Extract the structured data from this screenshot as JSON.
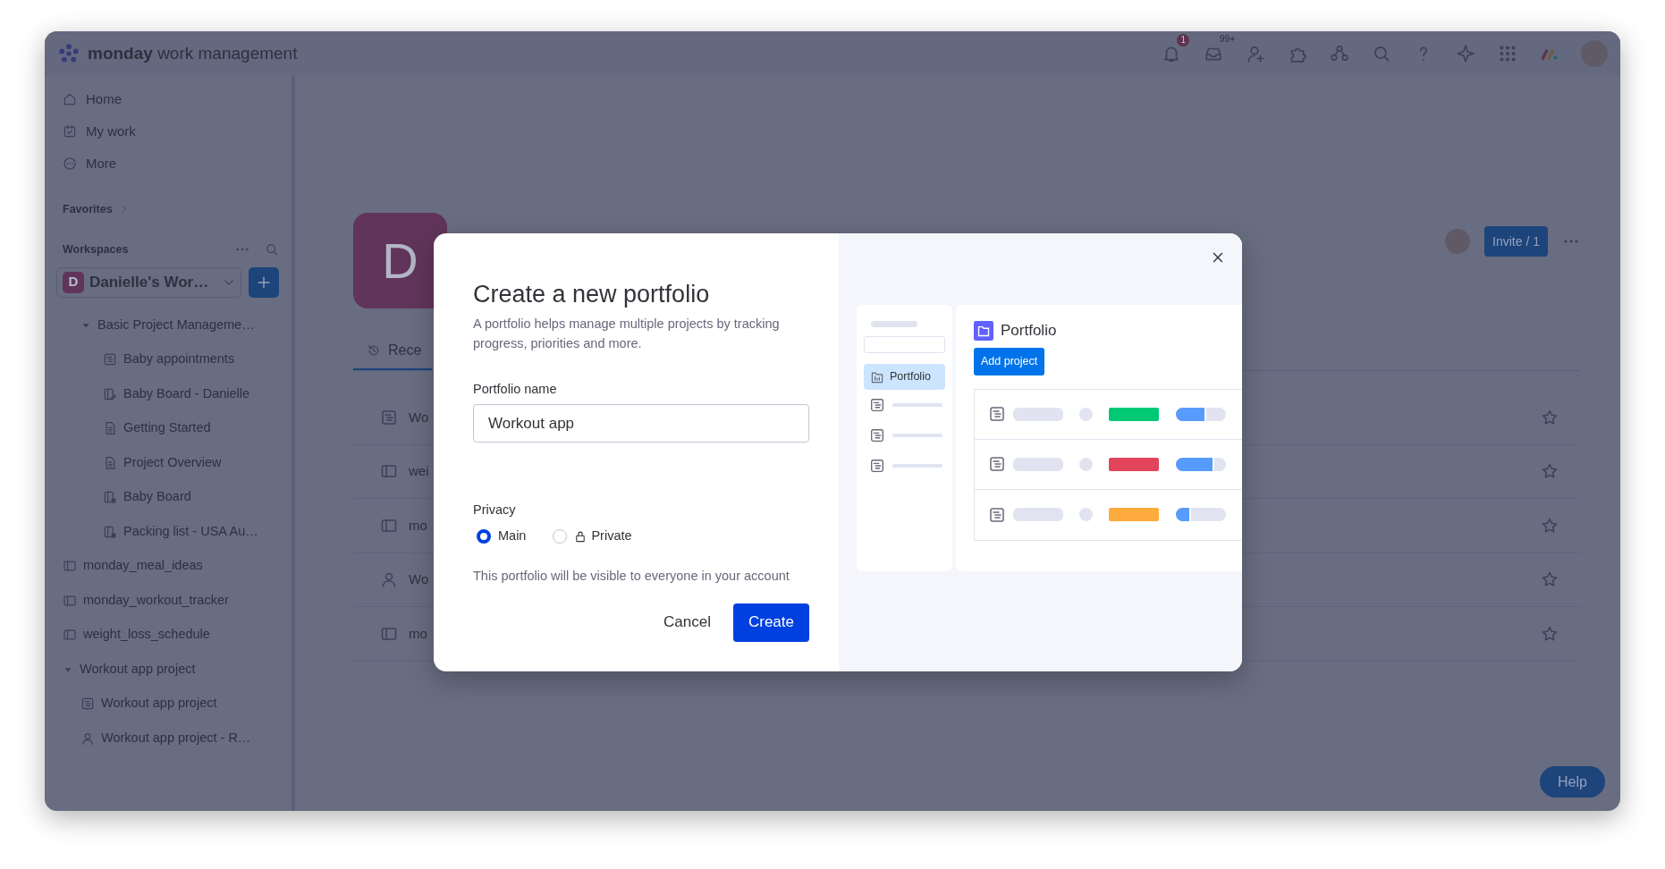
{
  "topbar": {
    "logo_bold": "monday",
    "logo_rest": "work management",
    "notifications_badge": "1",
    "inbox_badge": "99+"
  },
  "sidebar": {
    "nav": [
      {
        "label": "Home",
        "kind": "home"
      },
      {
        "label": "My work",
        "kind": "calendar"
      },
      {
        "label": "More",
        "kind": "more"
      }
    ],
    "favorites": "Favorites",
    "workspaces_label": "Workspaces",
    "workspace": {
      "initial": "D",
      "name": "Danielle's Wor…"
    },
    "tree": [
      {
        "label": "Basic Project Manageme…",
        "kind": "folder",
        "expanded": true,
        "children": [
          {
            "label": "Baby appointments",
            "kind": "board"
          },
          {
            "label": "Baby Board - Danielle",
            "kind": "shared"
          },
          {
            "label": "Getting Started",
            "kind": "doc"
          },
          {
            "label": "Project Overview",
            "kind": "doc"
          },
          {
            "label": "Baby Board",
            "kind": "locked"
          },
          {
            "label": "Packing list - USA Au…",
            "kind": "locked"
          }
        ]
      },
      {
        "label": "monday_meal_ideas",
        "kind": "table"
      },
      {
        "label": "monday_workout_tracker",
        "kind": "table"
      },
      {
        "label": "weight_loss_schedule",
        "kind": "table"
      },
      {
        "label": "Workout app project",
        "kind": "folder",
        "expanded": true,
        "children": [
          {
            "label": "Workout app project",
            "kind": "board"
          },
          {
            "label": "Workout app project - R…",
            "kind": "person"
          }
        ]
      }
    ]
  },
  "page": {
    "initial": "D",
    "tab": "Rece",
    "invite": "Invite / 1",
    "rows": [
      {
        "text": "Wo",
        "kind": "board"
      },
      {
        "text": "wei",
        "kind": "table"
      },
      {
        "text": "mo",
        "kind": "table"
      },
      {
        "text": "Wo",
        "kind": "person"
      },
      {
        "text": "mo",
        "kind": "table"
      }
    ]
  },
  "dialog": {
    "title": "Create a new portfolio",
    "description": "A portfolio helps manage multiple projects by tracking progress, priorities and more.",
    "name_label": "Portfolio name",
    "name_value": "Workout app",
    "privacy_label": "Privacy",
    "privacy_options": [
      {
        "label": "Main",
        "selected": true,
        "locked": false
      },
      {
        "label": "Private",
        "selected": false,
        "locked": true
      }
    ],
    "note": "This portfolio will be visible to everyone in your account",
    "buttons": [
      {
        "label": "Cancel",
        "kind": "secondary"
      },
      {
        "label": "Create",
        "kind": "primary"
      }
    ],
    "preview": {
      "sidebar_item": "Portfolio",
      "title": "Portfolio",
      "button": "Add project",
      "rows": [
        {
          "color": "#00c875",
          "level": 0.6
        },
        {
          "color": "#e2445c",
          "level": 0.77
        },
        {
          "color": "#fdab3d",
          "level": 0.3
        }
      ]
    }
  },
  "help": "Help"
}
